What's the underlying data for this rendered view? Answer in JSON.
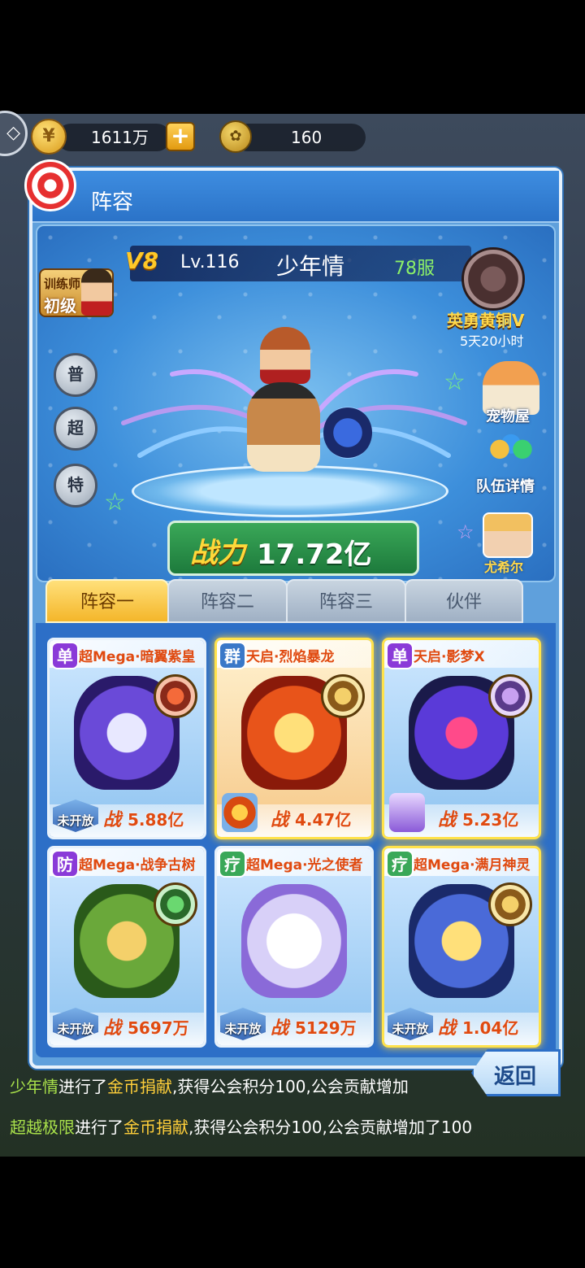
{
  "resources": {
    "gold_amount": "1611万",
    "pet_food_amount": "160",
    "gold_icon": "gold-coin-icon",
    "add_icon": "plus-icon",
    "pet_food_icon": "pet-food-icon"
  },
  "panel": {
    "title": "阵容"
  },
  "profile": {
    "vip": "V8",
    "level": "Lv.116",
    "name": "少年情",
    "server": "78服",
    "trainer_line1": "训练师",
    "trainer_line2": "初级",
    "rank_name": "英勇黄铜V",
    "rank_time": "5天20小时"
  },
  "side_buttons": {
    "normal": "普",
    "super": "超",
    "special": "特"
  },
  "right_menu": {
    "pet_house": "宠物屋",
    "team_details": "队伍详情",
    "partner_name": "尤希尔"
  },
  "power": {
    "label": "战力",
    "value": "17.72亿"
  },
  "tabs": [
    {
      "label": "阵容一",
      "active": true
    },
    {
      "label": "阵容二",
      "active": false
    },
    {
      "label": "阵容三",
      "active": false
    },
    {
      "label": "伙伴",
      "active": false
    }
  ],
  "cards": [
    {
      "role": "单",
      "name": "超Mega·暗翼紫皇",
      "status": "未开放",
      "power_label": "战",
      "power": "5.88亿"
    },
    {
      "role": "群",
      "name": "天启·烈焰暴龙",
      "status": "",
      "power_label": "战",
      "power": "4.47亿"
    },
    {
      "role": "单",
      "name": "天启·影梦X",
      "status": "",
      "power_label": "战",
      "power": "5.23亿"
    },
    {
      "role": "防",
      "name": "超Mega·战争古树",
      "status": "未开放",
      "power_label": "战",
      "power": "5697万"
    },
    {
      "role": "疗",
      "name": "超Mega·光之使者",
      "status": "未开放",
      "power_label": "战",
      "power": "5129万"
    },
    {
      "role": "疗",
      "name": "超Mega·满月神灵",
      "status": "未开放",
      "power_label": "战",
      "power": "1.04亿"
    }
  ],
  "return_label": "返回",
  "chat": [
    {
      "player": "少年情",
      "action1": "进行了",
      "item": "金币捐献",
      "rest": ",获得公会积分100,公会贡献增加"
    },
    {
      "player": "超越极限",
      "action1": "进行了",
      "item": "金币捐献",
      "rest": ",获得公会积分100,公会贡献增加了100"
    }
  ],
  "colors": {
    "panel_blue": "#5fa0dc",
    "power_gold": "#ffd83a",
    "card_power_red": "#e04a10",
    "role_purple": "#8a3ad8",
    "role_green": "#3aa858"
  }
}
